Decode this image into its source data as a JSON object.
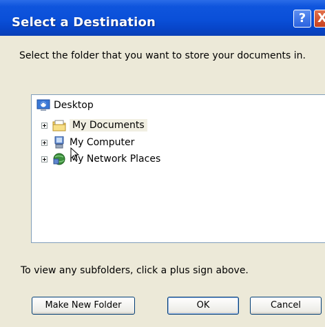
{
  "window": {
    "title": "Select a Destination",
    "help_label": "?",
    "close_label": "X"
  },
  "instruction": "Select the folder that you want to store your documents in.",
  "tree": {
    "items": [
      {
        "label": "Desktop",
        "icon": "desktop-icon"
      },
      {
        "label": "My Documents",
        "icon": "folder-icon",
        "selected": true
      },
      {
        "label": "My Computer",
        "icon": "computer-icon"
      },
      {
        "label": "My Network Places",
        "icon": "network-icon"
      }
    ]
  },
  "hint": "To view any subfolders, click a plus sign above.",
  "buttons": {
    "make_new_folder": "Make New Folder",
    "ok": "OK",
    "cancel": "Cancel"
  },
  "colors": {
    "titlebar": "#0a4fd8",
    "dialog_bg": "#ece9d8",
    "tree_border": "#7f9db9"
  }
}
